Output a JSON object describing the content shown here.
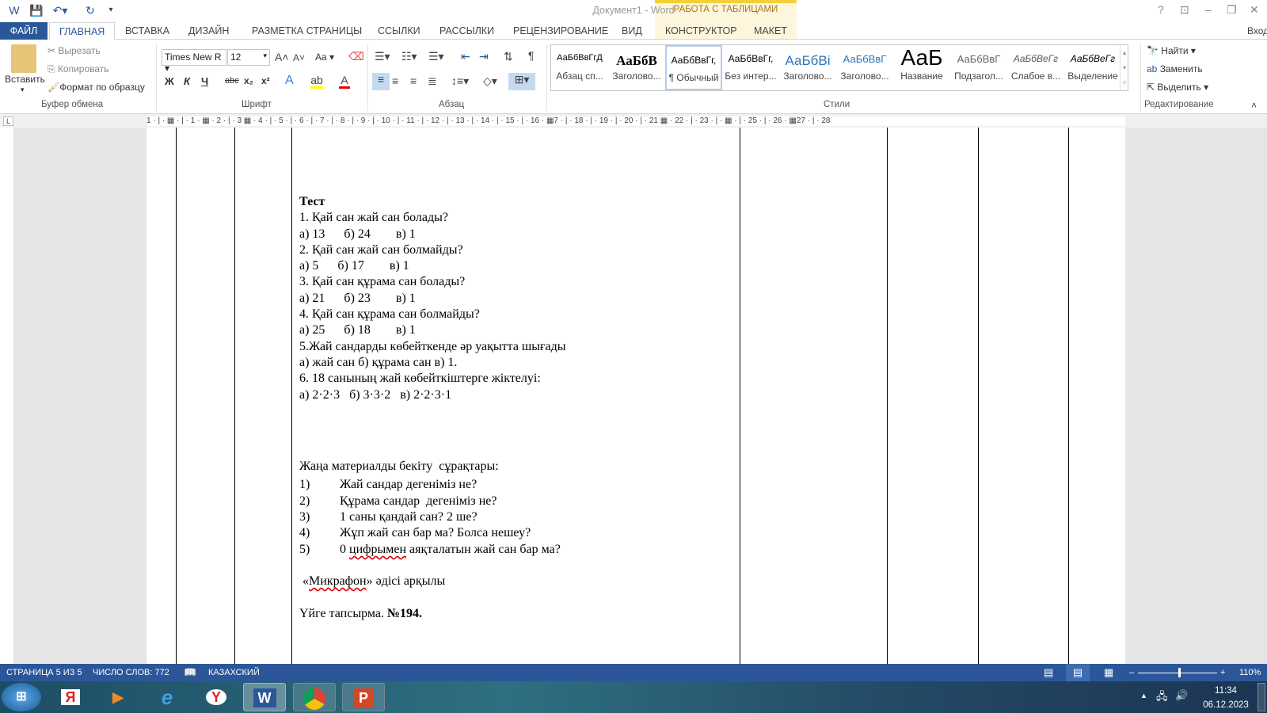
{
  "window": {
    "title": "Документ1 - Word",
    "context_tab_group": "РАБОТА С ТАБЛИЦАМИ",
    "sign_in": "Вход",
    "help": "?"
  },
  "tabs": [
    "ФАЙЛ",
    "ГЛАВНАЯ",
    "ВСТАВКА",
    "ДИЗАЙН",
    "РАЗМЕТКА СТРАНИЦЫ",
    "ССЫЛКИ",
    "РАССЫЛКИ",
    "РЕЦЕНЗИРОВАНИЕ",
    "ВИД",
    "КОНСТРУКТОР",
    "МАКЕТ"
  ],
  "clipboard": {
    "paste": "Вставить",
    "cut": "Вырезать",
    "copy": "Копировать",
    "format_painter": "Формат по образцу",
    "label": "Буфер обмена"
  },
  "font": {
    "name": "Times New R",
    "size": "12",
    "label": "Шрифт",
    "bold": "Ж",
    "italic": "К",
    "underline": "Ч",
    "strike": "abc",
    "sub": "x₂",
    "sup": "x²",
    "case": "Aa"
  },
  "paragraph": {
    "label": "Абзац"
  },
  "styles": {
    "label": "Стили",
    "items": [
      {
        "preview": "АаБбВвГгД",
        "name": "Абзац сп..."
      },
      {
        "preview": "АаБбВ",
        "name": "Заголово..."
      },
      {
        "preview": "АаБбВвГг,",
        "name": "¶ Обычный"
      },
      {
        "preview": "АаБбВвГг,",
        "name": "Без интер..."
      },
      {
        "preview": "АаБбВі",
        "name": "Заголово..."
      },
      {
        "preview": "АаБбВвГ",
        "name": "Заголово..."
      },
      {
        "preview": "АаБ",
        "name": "Название"
      },
      {
        "preview": "АаБбВвГ",
        "name": "Подзагол..."
      },
      {
        "preview": "АаБбВеГг",
        "name": "Слабое в..."
      },
      {
        "preview": "АаБбВеГг",
        "name": "Выделение"
      }
    ]
  },
  "editing": {
    "find": "Найти",
    "replace": "Заменить",
    "select": "Выделить",
    "label": "Редактирование"
  },
  "ruler": "1 · | · ▦ · | · 1 · ▦ · 2 · | · 3 ▦ · 4 · | · 5 · | · 6 · | · 7 · | · 8 · | · 9 · | · 10 · | · 11 · | · 12 · | · 13 · | · 14 · | · 15 · | · 16 · ▦7 · | · 18 · | · 19 · | · 20 · | · 21 ▦ · 22 · | · 23 · | · ▦ · | · 25 · | · 26 · ▦27 · | · 28",
  "document": {
    "test_title": "Тест",
    "test_lines": [
      "1. Қай сан жай сан болады?",
      "а) 13      б) 24        в) 1",
      "2. Қай сан жай сан болмайды?",
      "а) 5      б) 17        в) 1",
      "3. Қай сан құрама сан болады?",
      "а) 21      б) 23        в) 1",
      "4. Қай сан құрама сан болмайды?",
      "а) 25      б) 18        в) 1",
      "5.Жай сандарды көбейткенде әр уақытта шығады",
      "а) жай сан б) құрама сан в) 1.",
      "6. 18 санының жай көбейткіштерге жіктелуі:",
      "а) 2·2·3   б) 3·3·2   в) 2·2·3·1"
    ],
    "questions_title": "Жаңа материалды бекіту  сұрақтары:",
    "questions": [
      {
        "n": "1)",
        "t": "Жай сандар дегеніміз не?"
      },
      {
        "n": "2)",
        "t": "Құрама сандар  дегеніміз не?"
      },
      {
        "n": "3)",
        "t": "1 саны қандай сан? 2 ше?"
      },
      {
        "n": "4)",
        "t": "Жұп жай сан бар ма? Болса нешеу?"
      },
      {
        "n": "5)",
        "t_pre": "0 ",
        "t_sq": "цифрымен",
        "t_post": " аяқталатын жай сан бар ма?"
      }
    ],
    "method_pre": " «",
    "method_sq": "Микрафон",
    "method_post": "» әдісі арқылы",
    "homework": "Үйге тапсырма. ",
    "homework_bold": "№194."
  },
  "status": {
    "page": "СТРАНИЦА 5 ИЗ 5",
    "words": "ЧИСЛО СЛОВ: 772",
    "language": "КАЗАХСКИЙ",
    "zoom": "110%"
  },
  "taskbar": {
    "time": "11:34",
    "date": "06.12.2023",
    "apps": [
      "Я",
      "W",
      "P"
    ]
  },
  "colors": {
    "accent": "#2b579a",
    "context": "#f3cf3a"
  }
}
